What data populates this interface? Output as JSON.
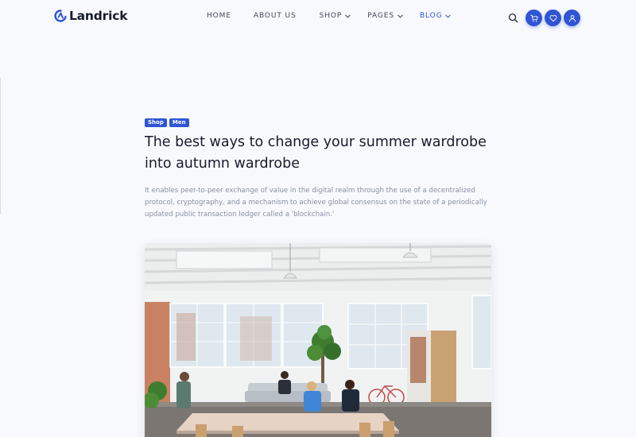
{
  "brand": {
    "name": "Landrick",
    "accent": "#2f55d4",
    "logo_icon": "landrick-logo-icon"
  },
  "nav": {
    "items": [
      {
        "label": "Home",
        "has_dropdown": false,
        "active": false
      },
      {
        "label": "About us",
        "has_dropdown": false,
        "active": false
      },
      {
        "label": "Shop",
        "has_dropdown": true,
        "active": false
      },
      {
        "label": "Pages",
        "has_dropdown": true,
        "active": false
      },
      {
        "label": "Blog",
        "has_dropdown": true,
        "active": true
      }
    ]
  },
  "header_actions": {
    "search_icon": "search-icon",
    "cart_icon": "cart-icon",
    "wishlist_icon": "heart-icon",
    "account_icon": "user-icon"
  },
  "post": {
    "tags": [
      "Shop",
      "Men"
    ],
    "title_line1": "The best ways to change your summer wardrobe",
    "title_line2": "into autumn wardrobe",
    "desc_line1": "It enables peer-to-peer exchange of value in the digital realm through the use of a decentralized",
    "desc_line2": "protocol, cryptography, and a mechanism to achieve global consensus on the state of a periodically",
    "desc_line3": "updated public transaction ledger called a 'blockchain.'",
    "image": "office-workspace-photo"
  },
  "colors": {
    "background": "#f8f9fc",
    "heading": "#161c2d",
    "muted": "#8492a6",
    "nav_text": "#3c4858"
  }
}
